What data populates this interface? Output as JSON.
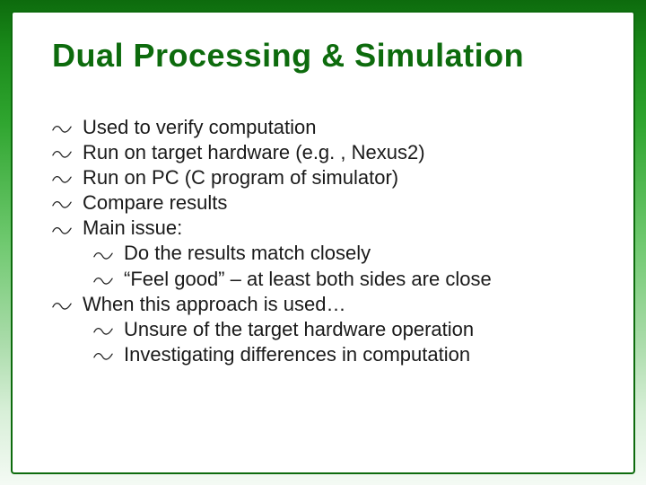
{
  "slide": {
    "title": "Dual Processing  & Simulation",
    "items": [
      {
        "text": "Used to verify computation",
        "level": 0
      },
      {
        "text": "Run on target hardware (e.g. , Nexus2)",
        "level": 0
      },
      {
        "text": "Run on PC (C program of simulator)",
        "level": 0
      },
      {
        "text": "Compare results",
        "level": 0
      },
      {
        "text": "Main issue:",
        "level": 0
      },
      {
        "text": "Do the results match closely",
        "level": 1
      },
      {
        "text": "“Feel good” – at least both sides are close",
        "level": 1
      },
      {
        "text": "When this approach is used…",
        "level": 0
      },
      {
        "text": "Unsure of the target hardware operation",
        "level": 1
      },
      {
        "text": "Investigating differences in computation",
        "level": 1
      }
    ]
  },
  "colors": {
    "titleColor": "#0d6b0d",
    "frameBorder": "#0d6b0d"
  }
}
